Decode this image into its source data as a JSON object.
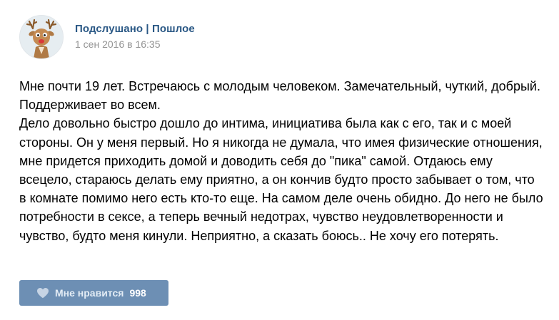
{
  "post": {
    "author": "Подслушано | Пошлое",
    "date": "1 сен 2016 в 16:35",
    "avatar_icon": "deer-avatar-icon",
    "paragraphs": [
      "Мне почти 19 лет. Встречаюсь с молодым человеком. Замечательный, чуткий, добрый. Поддерживает во всем.",
      "Дело довольно быстро дошло до интима, инициатива была как с его, так и с моей стороны. Он у меня первый. Но я никогда не думала, что имея физические отношения, мне придется приходить домой и доводить себя до \"пика\" самой. Отдаюсь ему всецело, стараюсь делать ему приятно, а он кончив будто просто забывает о том, что в комнате помимо него есть кто-то еще. На самом деле очень обидно. До него не было потребности в сексе, а теперь вечный недотрах, чувство неудовлетворенности и чувство, будто меня кинули. Неприятно, а сказать боюсь.. Не хочу его потерять."
    ]
  },
  "like": {
    "label": "Мне нравится",
    "count": "998",
    "icon": "heart-icon"
  },
  "colors": {
    "author": "#2a5885",
    "date": "#939393",
    "like_button_bg": "#6d8fb4",
    "like_label": "#e3ecf5",
    "text": "#000000"
  }
}
